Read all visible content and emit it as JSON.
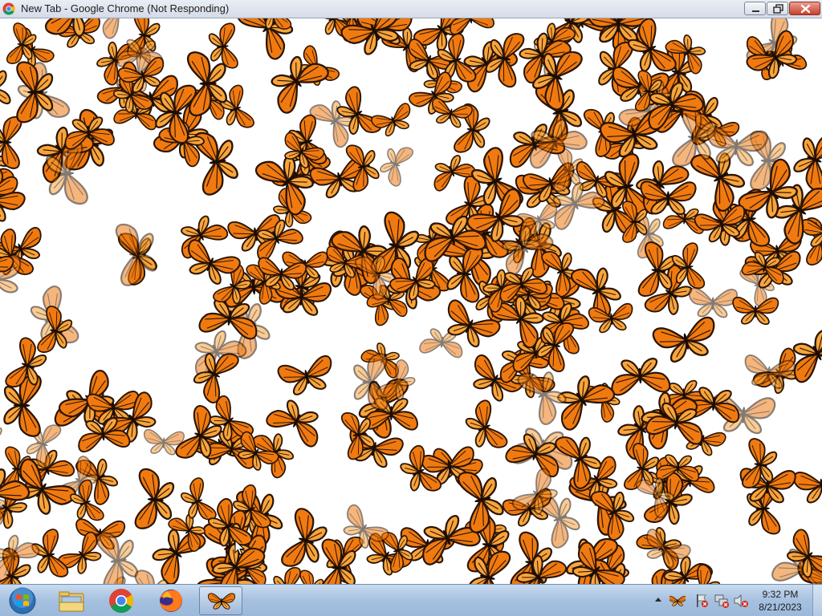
{
  "window": {
    "title": "New Tab - Google Chrome (Not Responding)",
    "app_icon": "chrome-icon",
    "controls": [
      "minimize-icon",
      "maximize-icon",
      "close-icon"
    ]
  },
  "content": {
    "description_icon": "butterfly",
    "colors": {
      "wing": "#f07a10",
      "wing_light": "#f9a43a",
      "vein": "#2a1406",
      "background": "#ffffff"
    }
  },
  "taskbar": {
    "start_icon": "windows-start-orb",
    "pinned": [
      {
        "name": "file-explorer",
        "icon": "folder-icon"
      },
      {
        "name": "google-chrome",
        "icon": "chrome-icon"
      },
      {
        "name": "firefox",
        "icon": "firefox-icon"
      },
      {
        "name": "butterflies-app",
        "icon": "butterfly-icon",
        "active": true
      }
    ],
    "tray_icons": [
      "show-hidden-icons-arrow",
      "butterfly-tray-icon",
      "action-center-flag-icon",
      "network-icon",
      "volume-muted-icon"
    ],
    "clock": {
      "time": "9:32 PM",
      "date": "8/21/2023"
    }
  }
}
